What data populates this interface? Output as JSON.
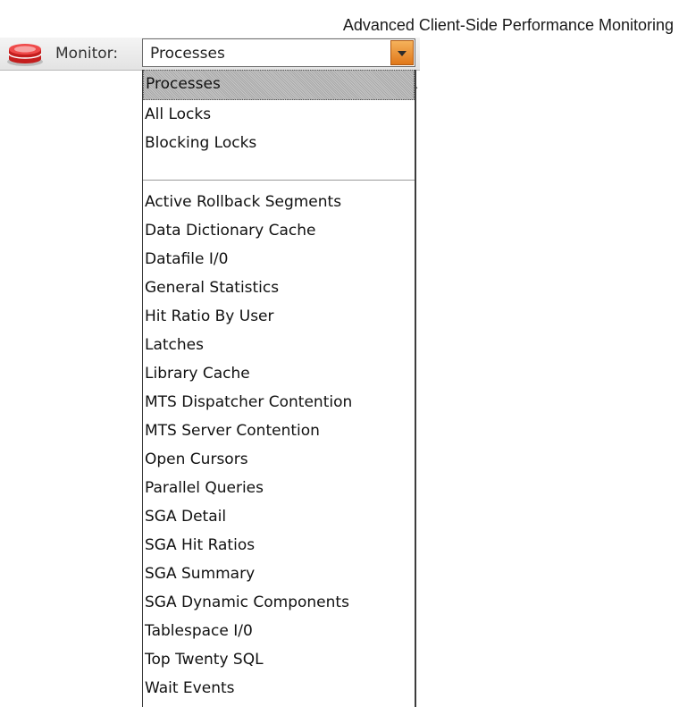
{
  "caption": "Advanced Client-Side Performance Monitoring",
  "toolbar": {
    "icon": "database-icon",
    "monitor_label": "Monitor:",
    "selected_value": "Processes"
  },
  "dropdown": {
    "top_items": [
      "Processes",
      "All Locks",
      "Blocking Locks"
    ],
    "bottom_items": [
      "Active Rollback Segments",
      "Data Dictionary Cache",
      "Datafile I/0",
      "General Statistics",
      "Hit Ratio By User",
      "Latches",
      "Library Cache",
      "MTS Dispatcher Contention",
      "MTS Server Contention",
      "Open Cursors",
      "Parallel Queries",
      "SGA Detail",
      "SGA Hit Ratios",
      "SGA Summary",
      "SGA Dynamic Components",
      "Tablespace I/0",
      "Top Twenty SQL",
      "Wait Events"
    ]
  },
  "colors": {
    "arrow_button": "#e0781a",
    "icon_red": "#d42b2b"
  }
}
